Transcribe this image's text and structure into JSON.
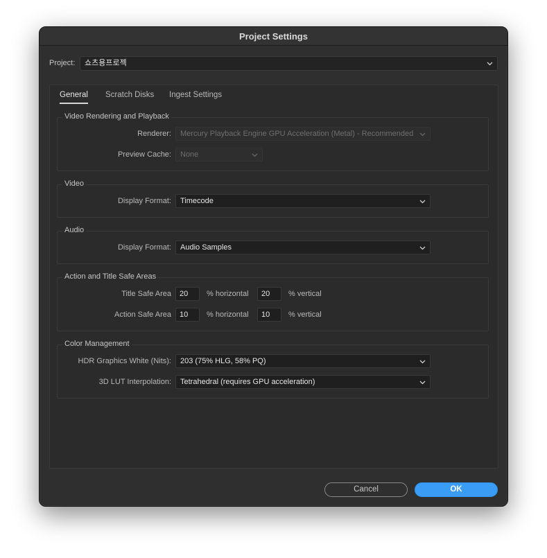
{
  "window": {
    "title": "Project Settings"
  },
  "project": {
    "label": "Project:",
    "value": "쇼츠용프로젝"
  },
  "tabs": [
    {
      "label": "General",
      "active": true
    },
    {
      "label": "Scratch Disks",
      "active": false
    },
    {
      "label": "Ingest Settings",
      "active": false
    }
  ],
  "video_rendering": {
    "title": "Video Rendering and Playback",
    "renderer_label": "Renderer:",
    "renderer_value": "Mercury Playback Engine GPU Acceleration (Metal) - Recommended",
    "preview_cache_label": "Preview Cache:",
    "preview_cache_value": "None"
  },
  "video": {
    "title": "Video",
    "display_format_label": "Display Format:",
    "display_format_value": "Timecode"
  },
  "audio": {
    "title": "Audio",
    "display_format_label": "Display Format:",
    "display_format_value": "Audio Samples"
  },
  "safe_areas": {
    "title": "Action and Title Safe Areas",
    "title_safe_label": "Title Safe Area",
    "title_safe_h": "20",
    "title_safe_v": "20",
    "action_safe_label": "Action Safe Area",
    "action_safe_h": "10",
    "action_safe_v": "10",
    "horizontal_unit": "% horizontal",
    "vertical_unit": "% vertical"
  },
  "color_management": {
    "title": "Color Management",
    "hdr_label": "HDR Graphics White (Nits):",
    "hdr_value": "203 (75% HLG, 58% PQ)",
    "lut_label": "3D LUT Interpolation:",
    "lut_value": "Tetrahedral (requires GPU acceleration)"
  },
  "buttons": {
    "cancel": "Cancel",
    "ok": "OK"
  },
  "colors": {
    "accent": "#3a9cf5",
    "background": "#2f2f2f",
    "panel": "#2b2b2b"
  }
}
